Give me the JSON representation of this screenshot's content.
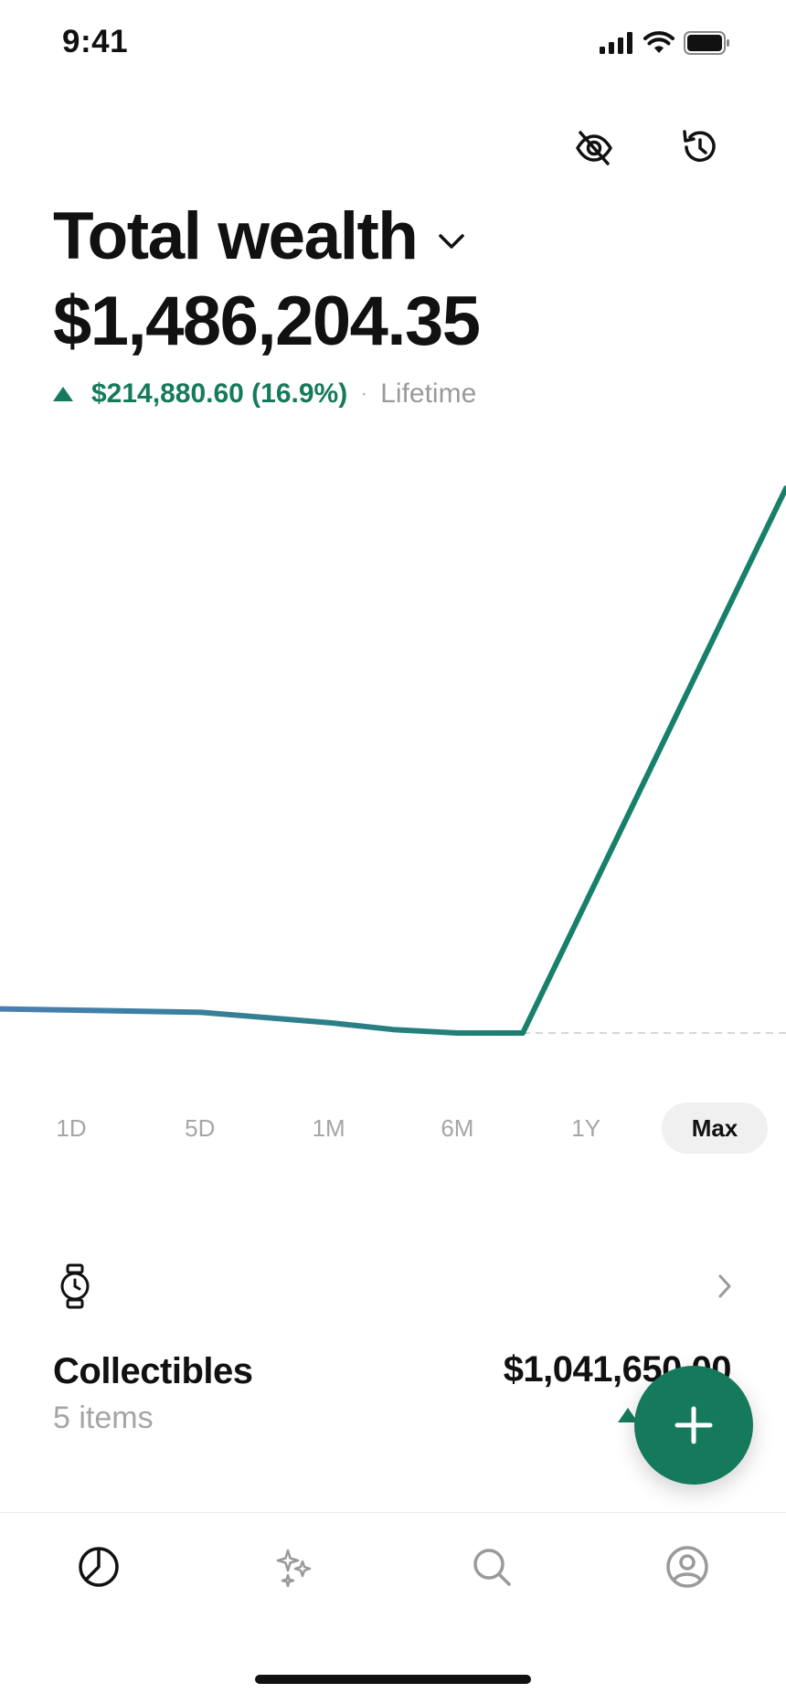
{
  "status_bar": {
    "time": "9:41"
  },
  "header": {
    "title": "Total wealth",
    "total_value": "$1,486,204.35",
    "change": {
      "value_text": "$214,880.60 (16.9%)",
      "separator": "·",
      "period": "Lifetime",
      "direction": "up",
      "color": "#167a5c"
    },
    "actions": [
      "eye-off-icon",
      "history-icon"
    ]
  },
  "chart_data": {
    "type": "line",
    "x": [
      "",
      "",
      "",
      "",
      "",
      "",
      ""
    ],
    "values": [
      100,
      99.9,
      99.6,
      99.4,
      99.3,
      99.3,
      115.1
    ],
    "baseline": 99.3,
    "color_start": "#4a7fb5",
    "color_end": "#17806a",
    "grid": false
  },
  "range_selector": {
    "options": [
      "1D",
      "5D",
      "1M",
      "6M",
      "1Y",
      "Max"
    ],
    "selected": "Max"
  },
  "collectibles": {
    "icon": "watch-icon",
    "title": "Collectibles",
    "subtitle": "5 items",
    "value": "$1,041,650.00",
    "direction": "up"
  },
  "fab": {
    "icon": "plus-icon",
    "color": "#157a5c"
  },
  "bottom_nav": {
    "items": [
      "portfolio-icon",
      "sparkles-icon",
      "search-icon",
      "profile-icon"
    ],
    "active": "portfolio-icon"
  }
}
